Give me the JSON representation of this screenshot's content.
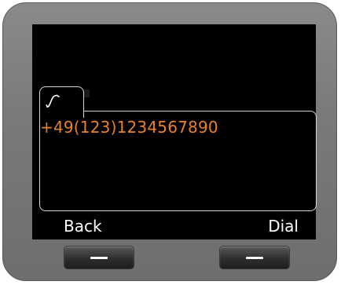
{
  "display": {
    "dialed_number": "+49(123)1234567890",
    "entry_tab_icon": "phone-handset-icon"
  },
  "softkeys": {
    "left_label": "Back",
    "right_label": "Dial"
  },
  "colors": {
    "number_text": "#e8822a",
    "screen_background": "#000000",
    "bezel": "#7a7a7a"
  }
}
